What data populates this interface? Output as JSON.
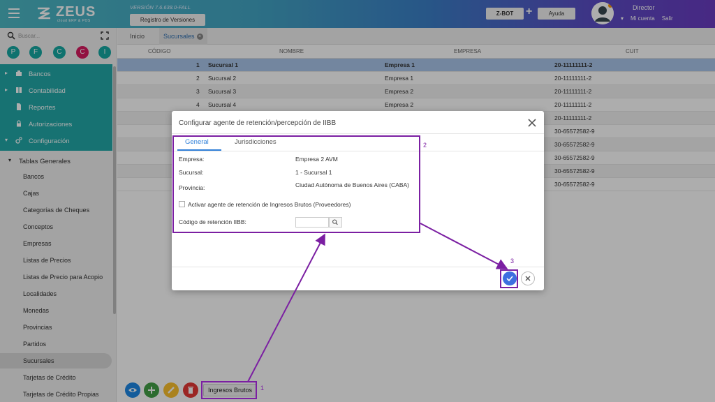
{
  "app": {
    "logo_text": "ZEUS",
    "logo_sub": "cloud ERP & POS",
    "version": "VERSIÓN 7.6.638.0-FALL",
    "registro_btn": "Registro de Versiones",
    "zbot_btn": "Z-BOT",
    "plus": "+",
    "ayuda_btn": "Ayuda",
    "user_name": "Director",
    "mi_cuenta": "Mi cuenta",
    "salir": "Salir"
  },
  "sidebar": {
    "search_placeholder": "Buscar...",
    "circles": [
      {
        "label": "P",
        "color": "#16a9a3"
      },
      {
        "label": "F",
        "color": "#16a9a3"
      },
      {
        "label": "C",
        "color": "#16a9a3"
      },
      {
        "label": "C",
        "color": "#d81b60"
      },
      {
        "label": "I",
        "color": "#16a9a3"
      }
    ],
    "main_items": [
      {
        "label": "Bancos",
        "icon": "bank-icon",
        "arrow": "▸"
      },
      {
        "label": "Contabilidad",
        "icon": "book-icon",
        "arrow": "▸"
      },
      {
        "label": "Reportes",
        "icon": "document-icon",
        "arrow": ""
      },
      {
        "label": "Autorizaciones",
        "icon": "lock-icon",
        "arrow": ""
      },
      {
        "label": "Configuración",
        "icon": "gears-icon",
        "arrow": "▾"
      }
    ],
    "group_title": "Tablas Generales",
    "group_arrow": "▾",
    "sub_items": [
      "Bancos",
      "Cajas",
      "Categorías de Cheques",
      "Conceptos",
      "Empresas",
      "Listas de Precios",
      "Listas de Precio para Acopio",
      "Localidades",
      "Monedas",
      "Provincias",
      "Partidos",
      "Sucursales",
      "Tarjetas de Crédito",
      "Tarjetas de Crédito Propias"
    ],
    "active_sub": "Sucursales"
  },
  "tabs": [
    {
      "label": "Inicio"
    },
    {
      "label": "Sucursales"
    }
  ],
  "table": {
    "headers": [
      "CÓDIGO",
      "NOMBRE",
      "EMPRESA",
      "CUIT"
    ],
    "rows": [
      {
        "codigo": "1",
        "nombre": "Sucursal 1",
        "empresa": "Empresa 1",
        "cuit": "20-11111111-2"
      },
      {
        "codigo": "2",
        "nombre": "Sucursal 2",
        "empresa": "Empresa 1",
        "cuit": "20-11111111-2"
      },
      {
        "codigo": "3",
        "nombre": "Sucursal 3",
        "empresa": "Empresa 2",
        "cuit": "20-11111111-2"
      },
      {
        "codigo": "4",
        "nombre": "Sucursal 4",
        "empresa": "Empresa 2",
        "cuit": "20-11111111-2"
      },
      {
        "codigo": "",
        "nombre": "",
        "empresa": "",
        "cuit": "20-11111111-2"
      },
      {
        "codigo": "",
        "nombre": "",
        "empresa": "",
        "cuit": "30-65572582-9"
      },
      {
        "codigo": "",
        "nombre": "",
        "empresa": "",
        "cuit": "30-65572582-9"
      },
      {
        "codigo": "",
        "nombre": "",
        "empresa": "",
        "cuit": "30-65572582-9"
      },
      {
        "codigo": "",
        "nombre": "",
        "empresa": "",
        "cuit": "30-65572582-9"
      },
      {
        "codigo": "",
        "nombre": "",
        "empresa": "",
        "cuit": "30-65572582-9"
      }
    ]
  },
  "bottom": {
    "ingresos_btn": "Ingresos Brutos",
    "fab_colors": {
      "view": "#1e88e5",
      "add": "#43a047",
      "edit": "#fbc02d",
      "delete": "#e53935"
    }
  },
  "modal": {
    "title": "Configurar agente de retención/percepción de IIBB",
    "tabs": [
      "General",
      "Jurisdicciones"
    ],
    "empresa_label": "Empresa:",
    "empresa_value": "Empresa 2 AVM",
    "sucursal_label": "Sucursal:",
    "sucursal_value": "1 - Sucursal 1",
    "provincia_label": "Provincia:",
    "provincia_value": "Ciudad Autónoma de Buenos Aires (CABA)",
    "checkbox_label": "Activar agente de retención de Ingresos Brutos (Proveedores)",
    "checkbox_checked": false,
    "codigo_label": "Código de retención IIBB:",
    "codigo_value": ""
  },
  "annotations": {
    "n1": "1",
    "n2": "2",
    "n3": "3",
    "color": "#7b1fa2"
  }
}
